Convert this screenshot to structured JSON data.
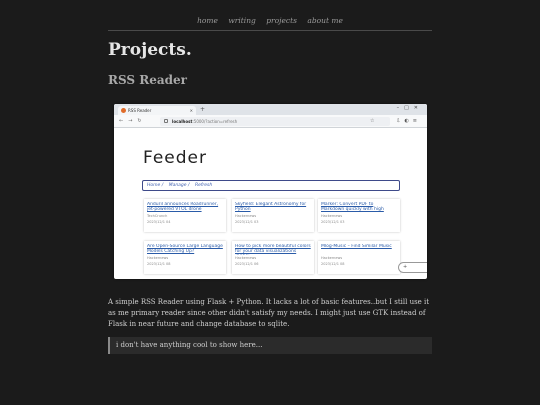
{
  "nav": {
    "home": "home",
    "writing": "writing",
    "projects": "projects",
    "about": "about me"
  },
  "page_title": "Projects.",
  "project": {
    "title": "RSS Reader",
    "screenshot": {
      "tab_label": "RSS Reader",
      "url_host": "localhost",
      "url_path": ":5000/?action=refresh",
      "app_title": "Feeder",
      "breadcrumbs": [
        "Home /",
        "Manage /",
        "Refresh"
      ],
      "cards": [
        {
          "title": "Anduril announces Roadrunner, jet-powered VTOL drone",
          "source": "TechCrunch",
          "date": "2023/12/1 04"
        },
        {
          "title": "Skyfield: Elegant Astronomy for Python",
          "source": "Hackernews",
          "date": "2023/12/1 03"
        },
        {
          "title": "Marker: Convert PDF to Markdown quickly with high accuracy",
          "source": "Hackernews",
          "date": "2023/12/1 03"
        },
        {
          "title": "Are Open-Source Large Language Models Catching Up?",
          "source": "Hackernews",
          "date": "2023/12/1 08"
        },
        {
          "title": "How to pick more beautiful colors for your data visualizations (2020)",
          "source": "Hackernews",
          "date": "2023/12/1 06"
        },
        {
          "title": "Mlog-Music – Find Similar Music",
          "source": "Hackernews",
          "date": "2023/12/1 08"
        }
      ],
      "fab_label": "+"
    },
    "description": "A simple RSS Reader using Flask + Python. It lacks a lot of basic features..but I still use it as me primary reader since other didn't satisfy my needs. I might just use GTK instead of Flask in near future and change database to sqlite.",
    "quote": "i don't have anything cool to show here..."
  }
}
